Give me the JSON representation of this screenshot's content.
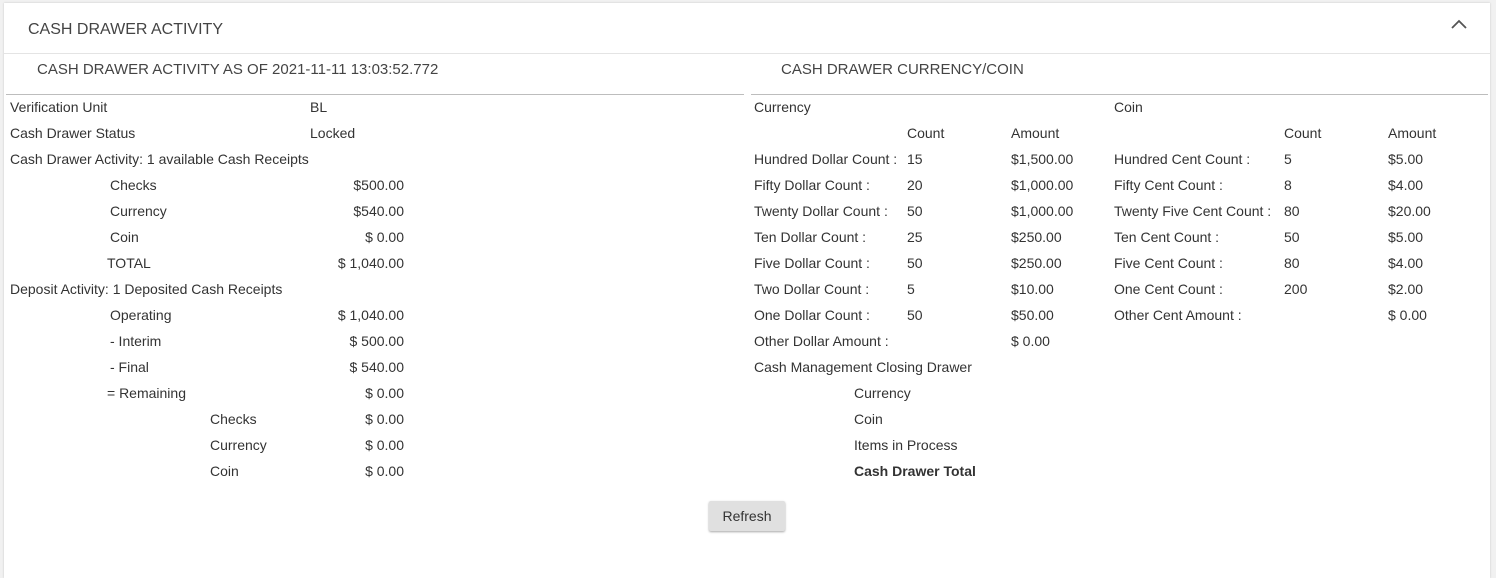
{
  "header": {
    "title": "CASH DRAWER ACTIVITY"
  },
  "activity": {
    "title": "CASH DRAWER ACTIVITY AS OF 2021-11-11 13:03:52.772",
    "verification_label": "Verification Unit",
    "verification_value": "BL",
    "status_label": "Cash Drawer Status",
    "status_value": "Locked",
    "receipts_heading": "Cash Drawer Activity: 1 available Cash Receipts",
    "receipts": [
      {
        "label": "Checks",
        "value": "$500.00"
      },
      {
        "label": "Currency",
        "value": "$540.00"
      },
      {
        "label": "Coin",
        "value": "$ 0.00"
      },
      {
        "label": "TOTAL",
        "value": "$ 1,040.00"
      }
    ],
    "deposit_heading": "Deposit Activity: 1 Deposited Cash Receipts",
    "deposits": [
      {
        "label": "Operating",
        "value": "$ 1,040.00"
      },
      {
        "label": "- Interim",
        "value": "$ 500.00"
      },
      {
        "label": "- Final",
        "value": "$ 540.00"
      },
      {
        "label": "= Remaining",
        "value": "$ 0.00"
      }
    ],
    "remaining": [
      {
        "label": "Checks",
        "value": "$ 0.00"
      },
      {
        "label": "Currency",
        "value": "$ 0.00"
      },
      {
        "label": "Coin",
        "value": "$ 0.00"
      }
    ]
  },
  "currency_coin": {
    "title": "CASH DRAWER CURRENCY/COIN",
    "currency_heading": "Currency",
    "coin_heading": "Coin",
    "count_header": "Count",
    "amount_header": "Amount",
    "currency_rows": [
      {
        "label": "Hundred Dollar Count :",
        "count": "15",
        "amount": "$1,500.00"
      },
      {
        "label": "Fifty Dollar Count :",
        "count": "20",
        "amount": "$1,000.00"
      },
      {
        "label": "Twenty Dollar Count :",
        "count": "50",
        "amount": "$1,000.00"
      },
      {
        "label": "Ten Dollar Count :",
        "count": "25",
        "amount": "$250.00"
      },
      {
        "label": "Five Dollar Count :",
        "count": "50",
        "amount": "$250.00"
      },
      {
        "label": "Two Dollar Count :",
        "count": "5",
        "amount": "$10.00"
      },
      {
        "label": "One Dollar Count :",
        "count": "50",
        "amount": "$50.00"
      },
      {
        "label": "Other Dollar Amount :",
        "count": "",
        "amount": "$ 0.00"
      }
    ],
    "coin_rows": [
      {
        "label": "Hundred Cent Count :",
        "count": "5",
        "amount": "$5.00"
      },
      {
        "label": "Fifty Cent Count :",
        "count": "8",
        "amount": "$4.00"
      },
      {
        "label": "Twenty Five Cent Count :",
        "count": "80",
        "amount": "$20.00"
      },
      {
        "label": "Ten Cent Count :",
        "count": "50",
        "amount": "$5.00"
      },
      {
        "label": "Five Cent Count :",
        "count": "80",
        "amount": "$4.00"
      },
      {
        "label": "One Cent Count :",
        "count": "200",
        "amount": "$2.00"
      },
      {
        "label": "Other Cent Amount :",
        "count": "",
        "amount": "$ 0.00"
      }
    ],
    "closing_heading": "Cash Management Closing Drawer",
    "closing_items": [
      "Currency",
      "Coin",
      "Items in Process"
    ],
    "closing_total": "Cash Drawer Total"
  },
  "refresh_label": "Refresh"
}
